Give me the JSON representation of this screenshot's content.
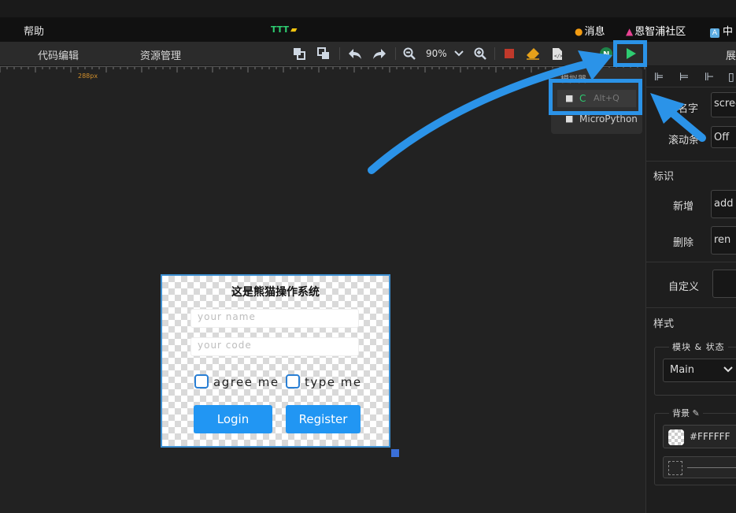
{
  "menubar": {
    "help": "帮助",
    "project": "TTT",
    "messages": "消息",
    "community": "恩智浦社区",
    "language": "中"
  },
  "toolbar": {
    "tab_code": "代码编辑",
    "tab_resources": "资源管理",
    "zoom": "90%",
    "expand": "展"
  },
  "ruler": {
    "marker": "288px"
  },
  "popup": {
    "header": "模拟器",
    "item_c_label": "C",
    "item_c_shortcut": "Alt+Q",
    "item_micropython": "MicroPython"
  },
  "screen": {
    "title": "这是熊猫操作系统",
    "name_placeholder": "your name",
    "code_placeholder": "your code",
    "check1": "agree me",
    "check2": "type me",
    "login": "Login",
    "register": "Register"
  },
  "panel": {
    "name_label": "名字",
    "name_value": "scree",
    "scrollbar_label": "滚动条",
    "scrollbar_value": "Off",
    "section_id": "标识",
    "add_label": "新增",
    "add_value": "add",
    "delete_label": "删除",
    "delete_value": "ren",
    "custom_label": "自定义",
    "section_style": "样式",
    "module_state": "模块 & 状态",
    "module_value": "Main",
    "background": "背景",
    "bg_color": "#FFFFFF"
  },
  "colors": {
    "accent": "#2b93e8",
    "button": "#2196f3",
    "run": "#2ecc71"
  }
}
